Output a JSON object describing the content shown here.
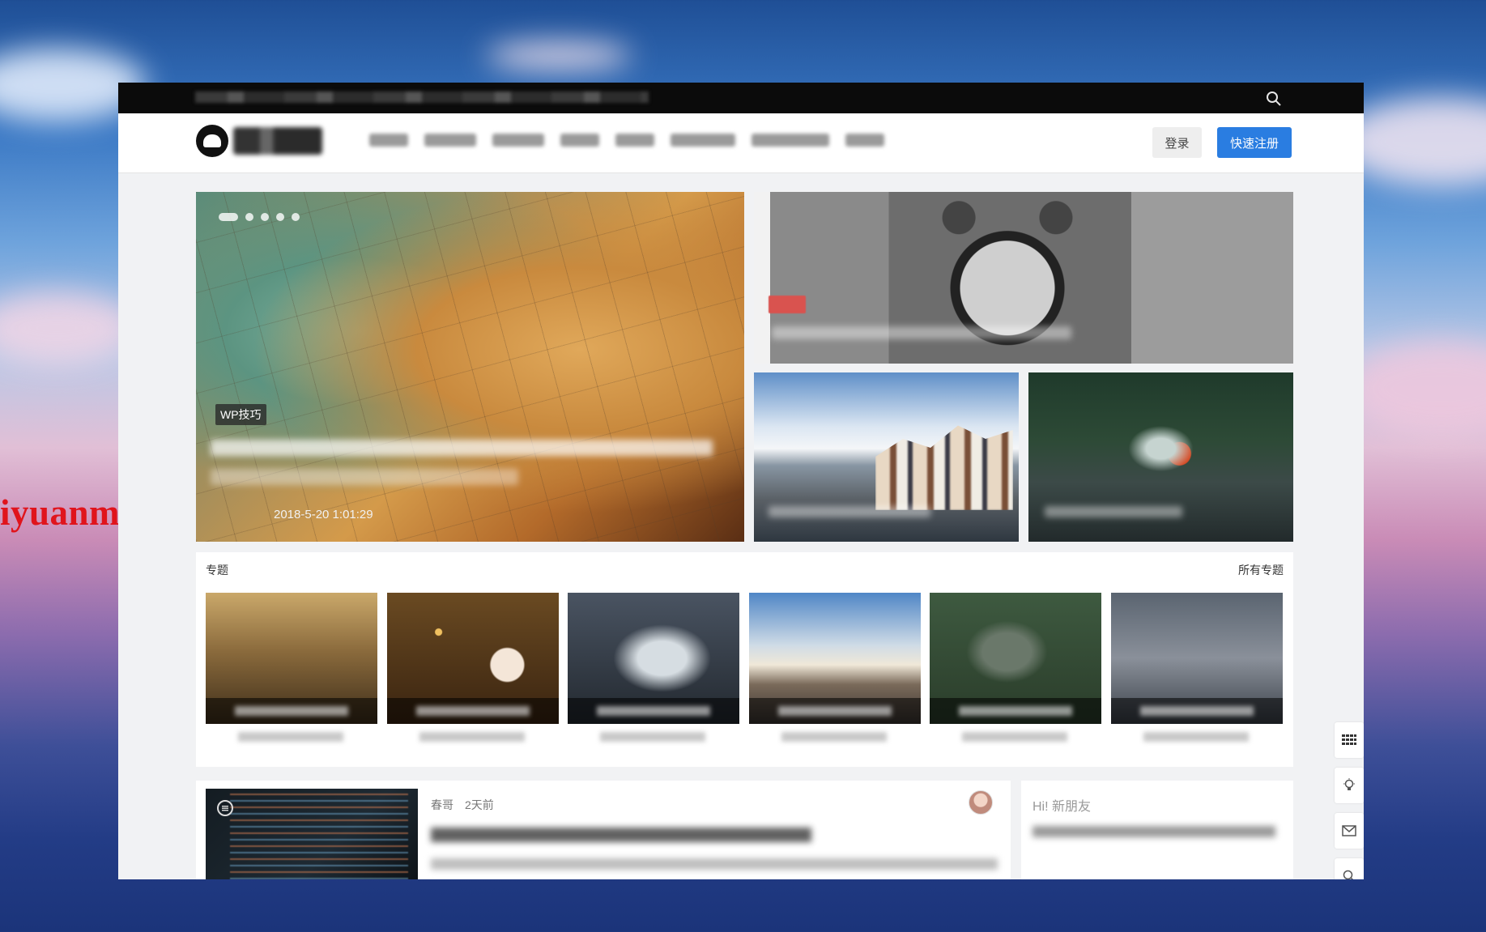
{
  "watermark": "iyuanmas.com",
  "header": {
    "login_label": "登录",
    "register_label": "快速注册",
    "nav_count": 8
  },
  "hero": {
    "category": "WP技巧",
    "date": "2018-5-20 1:01:29"
  },
  "topics": {
    "section_label": "专题",
    "more_label": "所有专题"
  },
  "post": {
    "author": "春哥",
    "time": "2天前"
  },
  "sidebar": {
    "greeting": "Hi! 新朋友"
  },
  "icons": {
    "topbar_search": "search-icon",
    "tools": [
      "grid-icon",
      "lightbulb-icon",
      "mail-icon",
      "search-icon"
    ]
  },
  "colors": {
    "accent": "#2a7de1",
    "watermark": "#e0141c",
    "topbar": "#0b0b0b"
  }
}
